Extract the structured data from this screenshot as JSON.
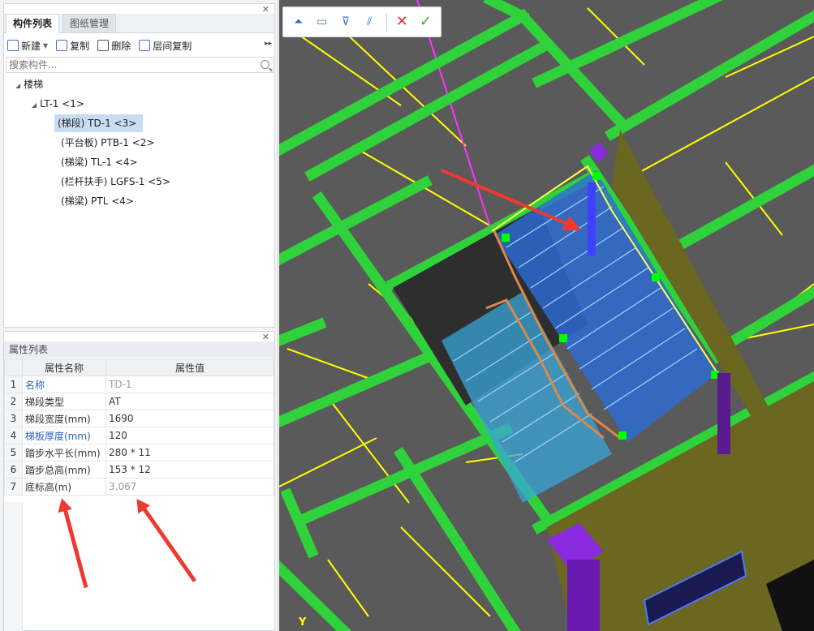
{
  "component_panel": {
    "tabs": [
      "构件列表",
      "图纸管理"
    ],
    "toolbar": {
      "new": "新建",
      "copy": "复制",
      "delete": "删除",
      "floor_copy": "层间复制"
    },
    "search_placeholder": "搜索构件...",
    "tree": {
      "root": "楼梯",
      "group": "LT-1 <1>",
      "items": [
        "(梯段) TD-1 <3>",
        "(平台板) PTB-1 <2>",
        "(梯梁) TL-1 <4>",
        "(栏杆扶手) LGFS-1 <5>",
        "(梯梁) PTL <4>"
      ]
    }
  },
  "property_panel": {
    "title": "属性列表",
    "headers": [
      "属性名称",
      "属性值"
    ],
    "rows": [
      {
        "num": "1",
        "name": "名称",
        "value": "TD-1"
      },
      {
        "num": "2",
        "name": "梯段类型",
        "value": "AT"
      },
      {
        "num": "3",
        "name": "梯段宽度(mm)",
        "value": "1690"
      },
      {
        "num": "4",
        "name": "梯板厚度(mm)",
        "value": "120"
      },
      {
        "num": "5",
        "name": "踏步水平长(mm)",
        "value": "280 * 11"
      },
      {
        "num": "6",
        "name": "踏步总高(mm)",
        "value": "153 * 12"
      },
      {
        "num": "7",
        "name": "底标高(m)",
        "value": "3.067"
      }
    ]
  },
  "viewport": {
    "axis_label": "Y",
    "tool_icons": [
      "stair-icon",
      "slab-icon",
      "railing-icon",
      "hatch-icon"
    ],
    "colors": {
      "beam": "#2fd23a",
      "background": "#5a5a5a",
      "accent_line": "#ffff00",
      "column": "#7a1fc0",
      "stair": "#3a8cff"
    }
  }
}
